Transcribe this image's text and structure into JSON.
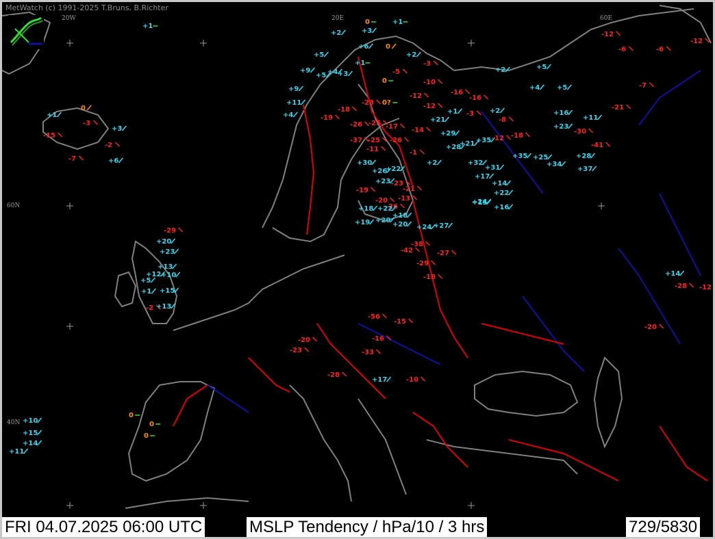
{
  "title_credit": "MetWatch  (c) 1991-2025 T.Bruns, B.Richter",
  "grid_labels": [
    "20W",
    "20E",
    "60E",
    "60N",
    "40N"
  ],
  "status": {
    "datetime": "FRI 04.07.2025 06:00 UTC",
    "product": "MSLP Tendency / hPa/10 / 3 hrs",
    "count": "729/5830"
  },
  "colors": {
    "positive": "#30d8f0",
    "negative": "#ff2020",
    "zero": "#ff8c00",
    "steady_marker": "#30e030",
    "coastline": "#808080",
    "borders": "#e00000",
    "rivers": "#1010a0"
  },
  "stations": [
    {
      "v": "+1",
      "k": "s"
    },
    {
      "v": "0",
      "k": "s"
    },
    {
      "v": "+1",
      "k": "s"
    },
    {
      "v": "+2",
      "k": "u"
    },
    {
      "v": "+3",
      "k": "u"
    },
    {
      "v": "+6",
      "k": "u"
    },
    {
      "v": "0",
      "k": "u"
    },
    {
      "v": "+2",
      "k": "u"
    },
    {
      "v": "+5",
      "k": "u"
    },
    {
      "v": "+4",
      "k": "u"
    },
    {
      "v": "+1",
      "k": "s"
    },
    {
      "v": "-5",
      "k": "d"
    },
    {
      "v": "-3",
      "k": "d"
    },
    {
      "v": "-12",
      "k": "d"
    },
    {
      "v": "-6",
      "k": "d"
    },
    {
      "v": "-6",
      "k": "d"
    },
    {
      "v": "-12",
      "k": "d"
    },
    {
      "v": "-7",
      "k": "d"
    },
    {
      "v": "+9",
      "k": "u"
    },
    {
      "v": "+5",
      "k": "u"
    },
    {
      "v": "+3",
      "k": "u"
    },
    {
      "v": "0",
      "k": "s"
    },
    {
      "v": "-10",
      "k": "d"
    },
    {
      "v": "-16",
      "k": "d"
    },
    {
      "v": "-16",
      "k": "d"
    },
    {
      "v": "+2",
      "k": "u"
    },
    {
      "v": "+5",
      "k": "u"
    },
    {
      "v": "+4",
      "k": "u"
    },
    {
      "v": "+5",
      "k": "u"
    },
    {
      "v": "+1",
      "k": "u"
    },
    {
      "v": "0",
      "k": "u"
    },
    {
      "v": "-3",
      "k": "d"
    },
    {
      "v": "+3",
      "k": "u"
    },
    {
      "v": "-15",
      "k": "d"
    },
    {
      "v": "-2",
      "k": "d"
    },
    {
      "v": "-7",
      "k": "d"
    },
    {
      "v": "+6",
      "k": "u"
    },
    {
      "v": "+9",
      "k": "u"
    },
    {
      "v": "+11",
      "k": "u"
    },
    {
      "v": "+4",
      "k": "u"
    },
    {
      "v": "-19",
      "k": "d"
    },
    {
      "v": "-18",
      "k": "d"
    },
    {
      "v": "-23",
      "k": "d"
    },
    {
      "v": "0?",
      "k": "z"
    },
    {
      "v": "-12",
      "k": "d"
    },
    {
      "v": "-12",
      "k": "d"
    },
    {
      "v": "+1",
      "k": "u"
    },
    {
      "v": "-3",
      "k": "d"
    },
    {
      "v": "+2",
      "k": "u"
    },
    {
      "v": "-8",
      "k": "d"
    },
    {
      "v": "+16",
      "k": "u"
    },
    {
      "v": "+23",
      "k": "u"
    },
    {
      "v": "+11",
      "k": "u"
    },
    {
      "v": "-21",
      "k": "d"
    },
    {
      "v": "-30",
      "k": "d"
    },
    {
      "v": "-41",
      "k": "d"
    },
    {
      "v": "-26",
      "k": "d"
    },
    {
      "v": "-25",
      "k": "d"
    },
    {
      "v": "-17",
      "k": "d"
    },
    {
      "v": "-14",
      "k": "d"
    },
    {
      "v": "+21",
      "k": "u"
    },
    {
      "v": "+29",
      "k": "u"
    },
    {
      "v": "+21",
      "k": "u"
    },
    {
      "v": "+35",
      "k": "u"
    },
    {
      "v": "-12",
      "k": "d"
    },
    {
      "v": "-18",
      "k": "d"
    },
    {
      "v": "-37",
      "k": "d"
    },
    {
      "v": "-25",
      "k": "d"
    },
    {
      "v": "-26",
      "k": "d"
    },
    {
      "v": "-11",
      "k": "d"
    },
    {
      "v": "-1",
      "k": "d"
    },
    {
      "v": "+2",
      "k": "u"
    },
    {
      "v": "+28",
      "k": "u"
    },
    {
      "v": "+32",
      "k": "u"
    },
    {
      "v": "+31",
      "k": "u"
    },
    {
      "v": "+35",
      "k": "u"
    },
    {
      "v": "+25",
      "k": "u"
    },
    {
      "v": "+34",
      "k": "u"
    },
    {
      "v": "+28",
      "k": "u"
    },
    {
      "v": "+37",
      "k": "u"
    },
    {
      "v": "+30",
      "k": "u"
    },
    {
      "v": "+26",
      "k": "u"
    },
    {
      "v": "+22",
      "k": "u"
    },
    {
      "v": "+23",
      "k": "u"
    },
    {
      "v": "-23",
      "k": "d"
    },
    {
      "v": "-19",
      "k": "d"
    },
    {
      "v": "-20",
      "k": "d"
    },
    {
      "v": "-21",
      "k": "d"
    },
    {
      "v": "-26",
      "k": "d"
    },
    {
      "v": "-13",
      "k": "d"
    },
    {
      "v": "+18",
      "k": "u"
    },
    {
      "v": "+22",
      "k": "u"
    },
    {
      "v": "+18",
      "k": "u"
    },
    {
      "v": "+17",
      "k": "u"
    },
    {
      "v": "+14",
      "k": "u"
    },
    {
      "v": "+24",
      "k": "u"
    },
    {
      "v": "+22",
      "k": "u"
    },
    {
      "v": "+15",
      "k": "u"
    },
    {
      "v": "+16",
      "k": "u"
    },
    {
      "v": "+19",
      "k": "u"
    },
    {
      "v": "+20",
      "k": "u"
    },
    {
      "v": "+20",
      "k": "u"
    },
    {
      "v": "+24",
      "k": "u"
    },
    {
      "v": "+27",
      "k": "u"
    },
    {
      "v": "-38",
      "k": "d"
    },
    {
      "v": "-42",
      "k": "d"
    },
    {
      "v": "-29",
      "k": "d"
    },
    {
      "v": "-27",
      "k": "d"
    },
    {
      "v": "-18",
      "k": "d"
    },
    {
      "v": "-23",
      "k": "d"
    },
    {
      "v": "-20",
      "k": "d"
    },
    {
      "v": "-28",
      "k": "d"
    },
    {
      "v": "-56",
      "k": "d"
    },
    {
      "v": "-29",
      "k": "d"
    },
    {
      "v": "+20",
      "k": "u"
    },
    {
      "v": "+23",
      "k": "u"
    },
    {
      "v": "+13",
      "k": "u"
    },
    {
      "v": "+12",
      "k": "u"
    },
    {
      "v": "+10",
      "k": "u"
    },
    {
      "v": "+5",
      "k": "u"
    },
    {
      "v": "+1",
      "k": "u"
    },
    {
      "v": "-2",
      "k": "d"
    },
    {
      "v": "+13",
      "k": "u"
    },
    {
      "v": "+15",
      "k": "u"
    },
    {
      "v": "+14",
      "k": "u"
    },
    {
      "v": "-28",
      "k": "d"
    },
    {
      "v": "-12",
      "k": "d"
    },
    {
      "v": "-20",
      "k": "d"
    },
    {
      "v": "-33",
      "k": "d"
    },
    {
      "v": "-16",
      "k": "d"
    },
    {
      "v": "-15",
      "k": "d"
    },
    {
      "v": "-10",
      "k": "d"
    },
    {
      "v": "+17",
      "k": "u"
    },
    {
      "v": "+10",
      "k": "u"
    },
    {
      "v": "+15",
      "k": "u"
    },
    {
      "v": "+14",
      "k": "u"
    },
    {
      "v": "+11",
      "k": "u"
    },
    {
      "v": "0",
      "k": "z"
    },
    {
      "v": "0",
      "k": "z"
    },
    {
      "v": "0",
      "k": "z"
    }
  ]
}
